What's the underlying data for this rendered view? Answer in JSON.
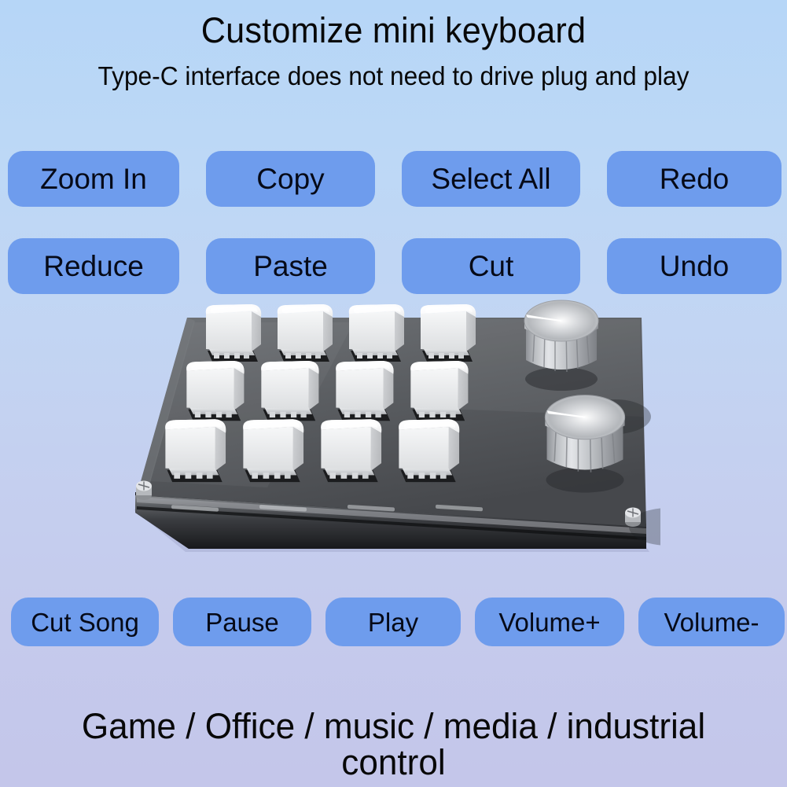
{
  "header": {
    "title": "Customize mini keyboard",
    "subtitle": "Type-C interface does not need to drive plug and play"
  },
  "shortcut_row_1": {
    "buttons": [
      {
        "label": "Zoom In"
      },
      {
        "label": "Copy"
      },
      {
        "label": "Select All"
      },
      {
        "label": "Redo"
      }
    ]
  },
  "shortcut_row_2": {
    "buttons": [
      {
        "label": "Reduce"
      },
      {
        "label": "Paste"
      },
      {
        "label": "Cut"
      },
      {
        "label": "Undo"
      }
    ]
  },
  "media_row": {
    "buttons": [
      {
        "label": "Cut Song"
      },
      {
        "label": "Pause"
      },
      {
        "label": "Play"
      },
      {
        "label": "Volume+"
      },
      {
        "label": "Volume-"
      }
    ]
  },
  "product": {
    "name": "mini-macro-keyboard",
    "key_rows": 3,
    "key_columns": 4,
    "key_count": 12,
    "knob_count": 2,
    "screw_count": 2,
    "keycap_color": "#ffffff",
    "base_color": "#4e5054",
    "knob_color": "#c9ccd0"
  },
  "footer": {
    "text": "Game / Office / music / media / industrial control"
  },
  "colors": {
    "background_top": "#b6d6f7",
    "background_bottom": "#c4c6ea",
    "button_fill": "#6e9ced",
    "text": "#080808"
  }
}
